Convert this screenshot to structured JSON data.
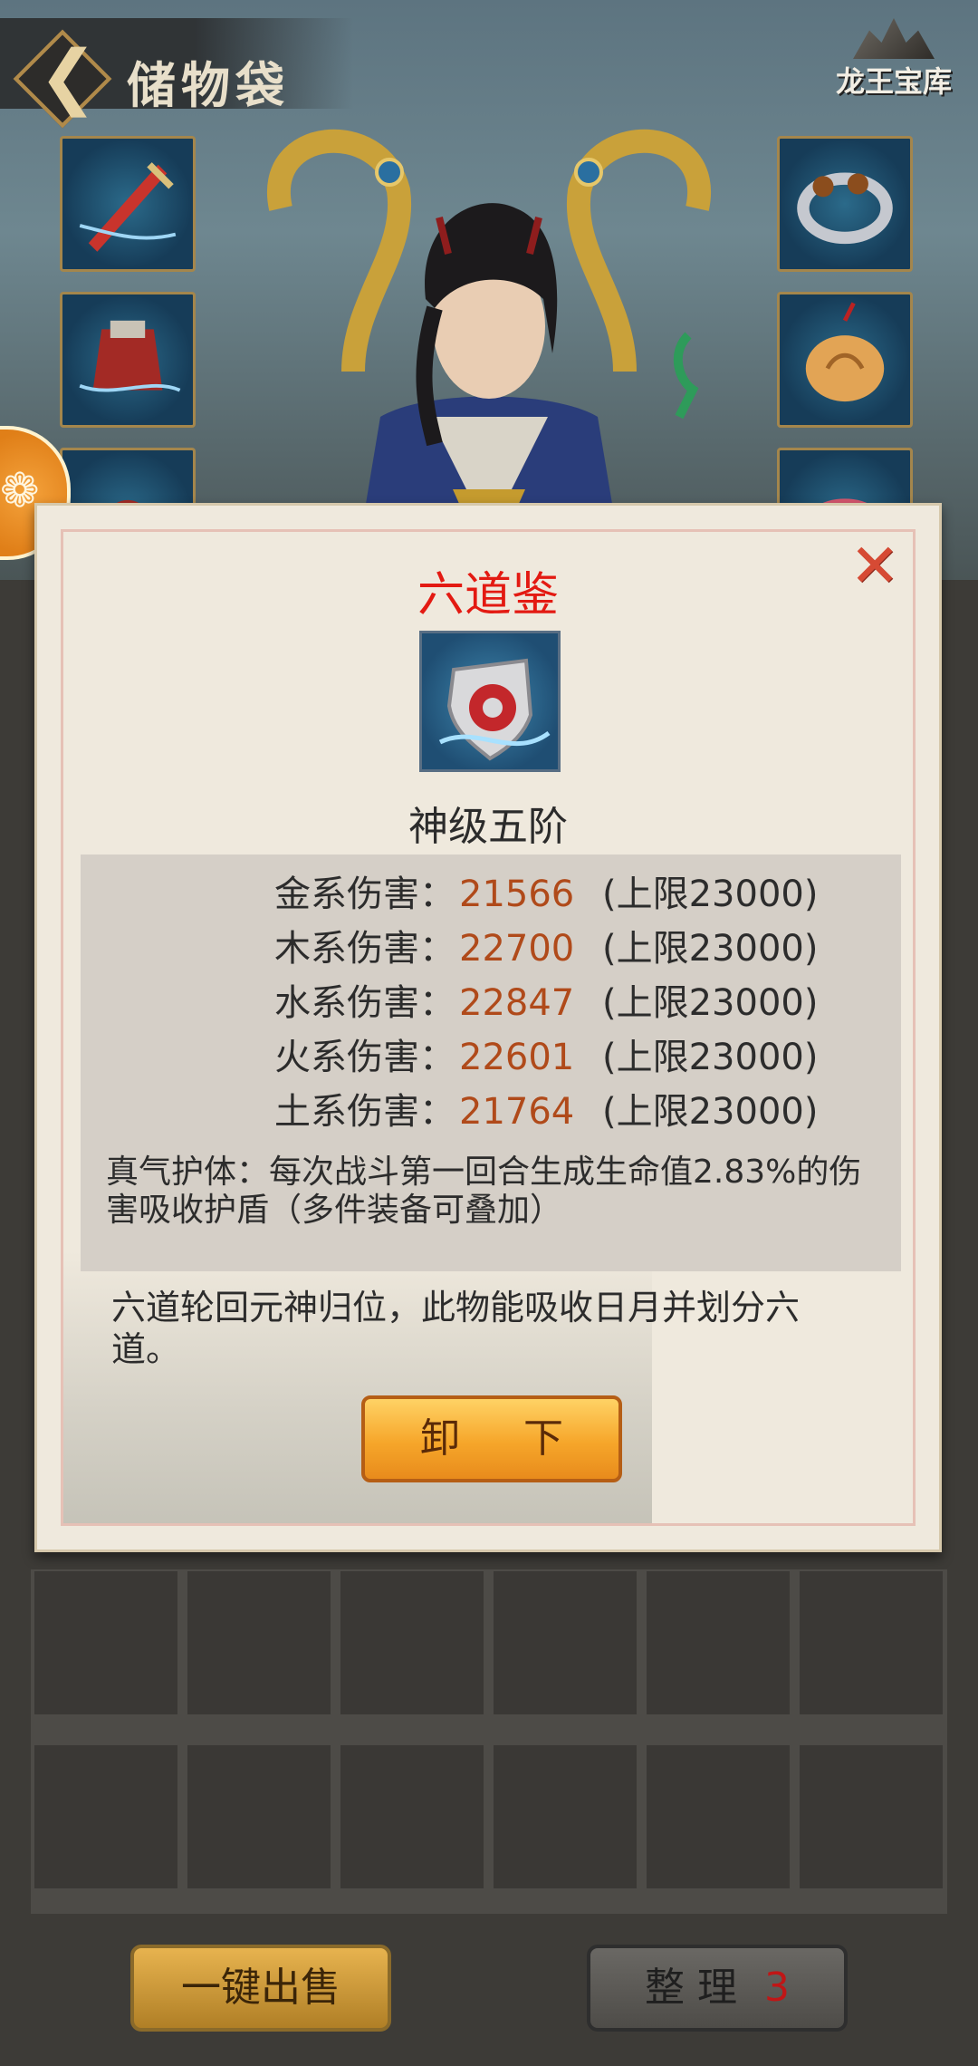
{
  "header": {
    "title": "储物袋",
    "treasury_label": "龙王宝库"
  },
  "equipment": {
    "left_slots": [
      "sword-icon",
      "armor-icon",
      "helmet-icon"
    ],
    "right_slots": [
      "bracelet-icon",
      "amulet-icon",
      "ring-icon"
    ]
  },
  "item_popup": {
    "name": "六道鉴",
    "icon": "shield-icon",
    "grade": "神级五阶",
    "stats": [
      {
        "label": "金系伤害：",
        "value": "21566",
        "cap": "(上限23000)"
      },
      {
        "label": "木系伤害：",
        "value": "22700",
        "cap": "(上限23000)"
      },
      {
        "label": "水系伤害：",
        "value": "22847",
        "cap": "(上限23000)"
      },
      {
        "label": "火系伤害：",
        "value": "22601",
        "cap": "(上限23000)"
      },
      {
        "label": "土系伤害：",
        "value": "21764",
        "cap": "(上限23000)"
      }
    ],
    "skill": "真气护体：每次战斗第一回合生成生命值2.83%的伤害吸收护盾（多件装备可叠加）",
    "description": "六道轮回元神归位，此物能吸收日月并划分六道。",
    "unequip_label": "卸 下",
    "colors": {
      "name": "#e31a12",
      "value": "#b04a1a"
    }
  },
  "bottom_bar": {
    "sell_all_label": "一键出售",
    "sort_label": "整 理",
    "sort_count": "3"
  }
}
